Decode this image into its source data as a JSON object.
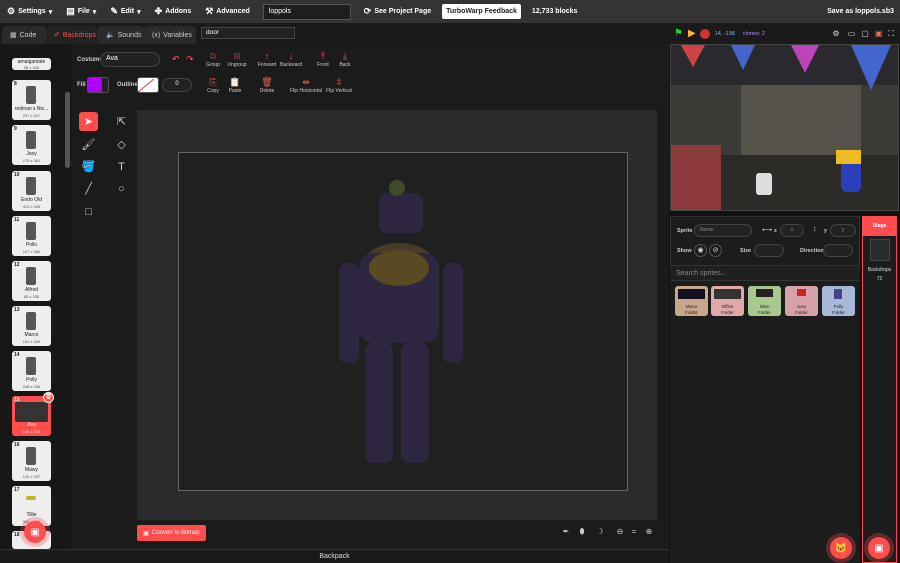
{
  "menubar": {
    "settings": "Settings",
    "file": "File",
    "edit": "Edit",
    "addons": "Addons",
    "advanced": "Advanced",
    "project_name": "loppols",
    "see_project_page": "See Project Page",
    "feedback": "TurboWarp Feedback",
    "blocks": "12,733 blocks",
    "save_as": "Save as loppols.sb3"
  },
  "tabs": {
    "code": "Code",
    "backdrops": "Backdrops",
    "sounds": "Sounds",
    "variables": "Variables"
  },
  "backdrop_search": "door",
  "costumes": [
    {
      "num": "",
      "name": "amalgamate",
      "size": "98 x 345"
    },
    {
      "num": "8",
      "name": "redman x Nic...",
      "size": "237 x 317"
    },
    {
      "num": "9",
      "name": "Joey",
      "size": "175 x 361"
    },
    {
      "num": "10",
      "name": "Endo Old",
      "size": "413 x 306"
    },
    {
      "num": "11",
      "name": "Pollo",
      "size": "107 x 360"
    },
    {
      "num": "12",
      "name": "Alfred",
      "size": "85 x 336"
    },
    {
      "num": "13",
      "name": "Marco",
      "size": "131 x 326"
    },
    {
      "num": "14",
      "name": "Polly",
      "size": "248 x 298"
    },
    {
      "num": "15",
      "name": "Ava",
      "size": "132 x 313"
    },
    {
      "num": "16",
      "name": "Mawy",
      "size": "126 x 337"
    },
    {
      "num": "17",
      "name": "Tillie",
      "size": "360 x 174"
    },
    {
      "num": "18",
      "name": "",
      "size": ""
    }
  ],
  "editor": {
    "costume_label": "Costume",
    "costume_name": "Ava",
    "fill_label": "Fill",
    "outline_label": "Outline",
    "outline_width": "0",
    "fill_color": "#b000ff",
    "buttons": {
      "group": "Group",
      "ungroup": "Ungroup",
      "forward": "Forward",
      "backward": "Backward",
      "front": "Front",
      "back": "Back",
      "copy": "Copy",
      "paste": "Paste",
      "delete": "Delete",
      "flip_h": "Flip Horizontal",
      "flip_v": "Flip Vertical"
    },
    "convert": "Convert to Bitmap"
  },
  "backpack": "Backpack",
  "stage_header": {
    "coords": "14, -198",
    "clones": "clones: 2"
  },
  "sprite_info": {
    "sprite_label": "Sprite",
    "name_placeholder": "Name",
    "x_label": "x",
    "x_placeholder": "x",
    "y_label": "y",
    "y_placeholder": "y",
    "show_label": "Show",
    "size_label": "Size",
    "direction_label": "Direction"
  },
  "sprite_search_placeholder": "Search sprites...",
  "folders": [
    {
      "name": "Menu",
      "sub": "Folder",
      "color": "#c8a78a"
    },
    {
      "name": "Office",
      "sub": "Folder",
      "color": "#e0a8a8"
    },
    {
      "name": "Misc",
      "sub": "Folder",
      "color": "#a8c890"
    },
    {
      "name": "Joey",
      "sub": "Folder",
      "color": "#d8a0a8"
    },
    {
      "name": "Polly",
      "sub": "Folder",
      "color": "#a8b8d8"
    }
  ],
  "stage_pane": {
    "label": "Stage",
    "backdrops_label": "Backdrops",
    "backdrops_count": "72"
  },
  "colors": {
    "accent": "#ff4c4c",
    "menubar": "#333333"
  }
}
